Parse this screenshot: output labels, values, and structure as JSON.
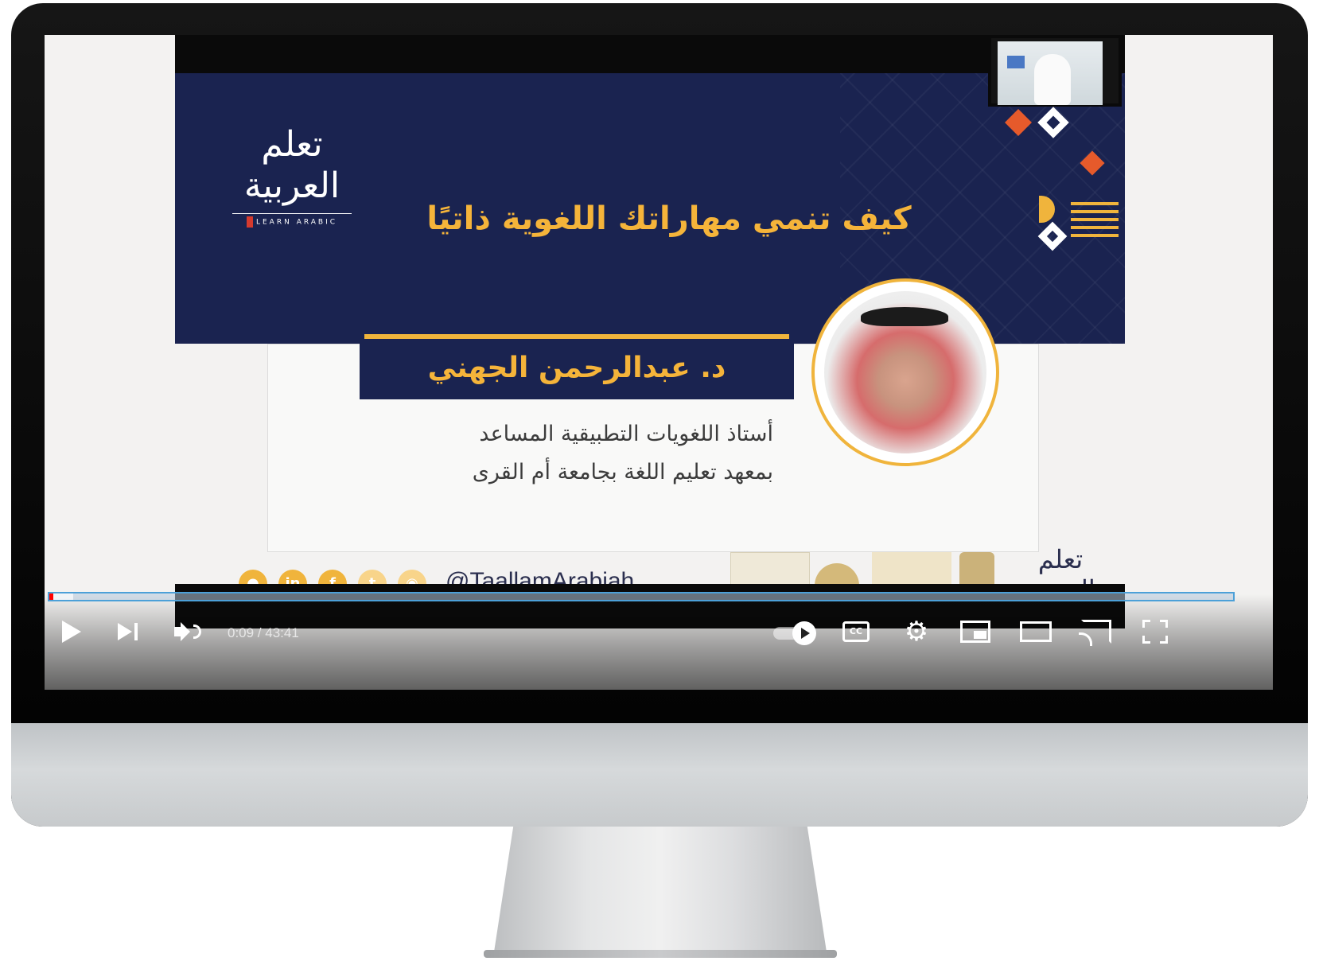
{
  "video": {
    "slide": {
      "logo_text": "تعلم العربية",
      "logo_subtext": "LEARN ARABIC",
      "title": "كيف تنمي مهاراتك اللغوية ذاتيًا",
      "speaker_name": "د. عبدالرحمن الجهني",
      "speaker_role_line1": "أستاذ اللغويات التطبيقية المساعد",
      "speaker_role_line2": "بمعهد تعليم اللغة  بجامعة أم القرى",
      "social_handle": "@TaallamArabiah",
      "footer_logo_text": "تعلم العربية",
      "social_icons": [
        "snapchat-icon",
        "linkedin-icon",
        "facebook-icon",
        "twitter-icon",
        "instagram-icon"
      ]
    },
    "player": {
      "current_time": "0:09",
      "duration": "43:41",
      "time_display": "0:09 / 43:41",
      "progress_fraction": 0.0034,
      "buffered_fraction": 0.02,
      "cc_label": "CC",
      "colors": {
        "progress": "#ff0000",
        "slide_navy": "#1a2350",
        "slide_gold": "#f5b43a"
      }
    }
  }
}
